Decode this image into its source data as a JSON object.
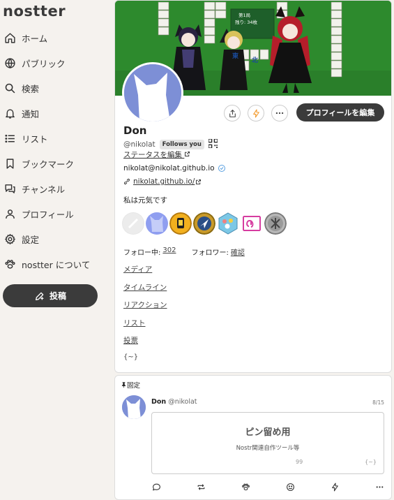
{
  "app": {
    "logo": "nostter"
  },
  "sidebar": {
    "items": [
      {
        "label": "ホーム",
        "icon": "home-icon"
      },
      {
        "label": "パブリック",
        "icon": "globe-icon"
      },
      {
        "label": "検索",
        "icon": "search-icon"
      },
      {
        "label": "通知",
        "icon": "bell-icon"
      },
      {
        "label": "リスト",
        "icon": "list-icon"
      },
      {
        "label": "ブックマーク",
        "icon": "bookmark-icon"
      },
      {
        "label": "チャンネル",
        "icon": "channel-icon"
      },
      {
        "label": "プロフィール",
        "icon": "user-icon"
      },
      {
        "label": "設定",
        "icon": "gear-icon"
      },
      {
        "label": "nostter について",
        "icon": "paw-icon"
      }
    ],
    "post_button": "投稿"
  },
  "profile": {
    "name": "Don",
    "handle": "@nikolat",
    "follows_badge": "Follows you",
    "status_link": "ステータスを編集",
    "nip05": "nikolat@nikolat.github.io",
    "website": "nikolat.github.io/",
    "about": "私は元気です",
    "edit_button": "プロフィールを編集",
    "following_label": "フォロー中:",
    "following_count": "302",
    "followers_label": "フォロワー:",
    "followers_value": "確認",
    "tabs": [
      "メディア",
      "タイムライン",
      "リアクション",
      "リスト",
      "投票"
    ],
    "tilde": "{~}",
    "banner_tiles": [
      "第1局",
      "残り: 34枚",
      "東",
      "北"
    ]
  },
  "pinned": {
    "label": "固定",
    "author": "Don",
    "handle": "@nikolat",
    "time": "8/15",
    "quote_title": "ピン留め用",
    "quote_subtitle": "Nostr関連自作ツール等",
    "quote_mark": "99",
    "quote_tilde": "{~}"
  },
  "colors": {
    "accent_dark": "#3b3b3b",
    "avatar_blue": "#7d8fd6",
    "banner_green": "#2d8a2d",
    "zap_orange": "#f39a2c"
  }
}
